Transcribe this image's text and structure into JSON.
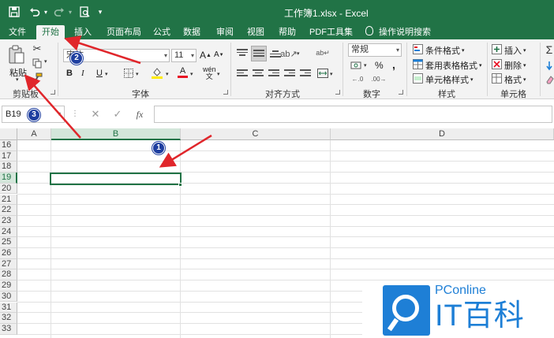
{
  "window": {
    "title": "工作簿1.xlsx  -  Excel"
  },
  "tabs": [
    {
      "label": "文件"
    },
    {
      "label": "开始"
    },
    {
      "label": "插入"
    },
    {
      "label": "页面布局"
    },
    {
      "label": "公式"
    },
    {
      "label": "数据"
    },
    {
      "label": "审阅"
    },
    {
      "label": "视图"
    },
    {
      "label": "帮助"
    },
    {
      "label": "PDF工具集"
    },
    {
      "label": "操作说明搜索"
    }
  ],
  "ribbon": {
    "clipboard": {
      "paste_label": "粘贴",
      "group_label": "剪贴板"
    },
    "font": {
      "font_name": "宋体",
      "font_size": "11",
      "group_label": "字体",
      "grow": "A",
      "shrink": "A",
      "wen": "wén",
      "bold": "B",
      "italic": "I",
      "underline": "U",
      "color_a": "A"
    },
    "alignment": {
      "group_label": "对齐方式"
    },
    "number": {
      "format": "常规",
      "percent": "%",
      "comma": ",",
      "group_label": "数字"
    },
    "styles": {
      "conditional": "条件格式",
      "table_format": "套用表格格式",
      "cell_styles": "单元格样式",
      "group_label": "样式"
    },
    "cells": {
      "insert": "插入",
      "delete": "删除",
      "format": "格式",
      "group_label": "单元格"
    }
  },
  "formula_bar": {
    "name_box": "B19",
    "cancel": "✕",
    "enter": "✓",
    "fx": "fx",
    "value": ""
  },
  "grid": {
    "columns": [
      "A",
      "B",
      "C",
      "D"
    ],
    "rows": [
      "16",
      "17",
      "18",
      "19",
      "20",
      "21",
      "22",
      "23",
      "24",
      "25",
      "26",
      "27",
      "28",
      "29",
      "30",
      "31",
      "32",
      "33"
    ],
    "selected_cell": "B19"
  },
  "annotations": [
    {
      "number": "1"
    },
    {
      "number": "2"
    },
    {
      "number": "3"
    }
  ],
  "watermark": {
    "brand": "PConline",
    "name": "IT百科"
  }
}
